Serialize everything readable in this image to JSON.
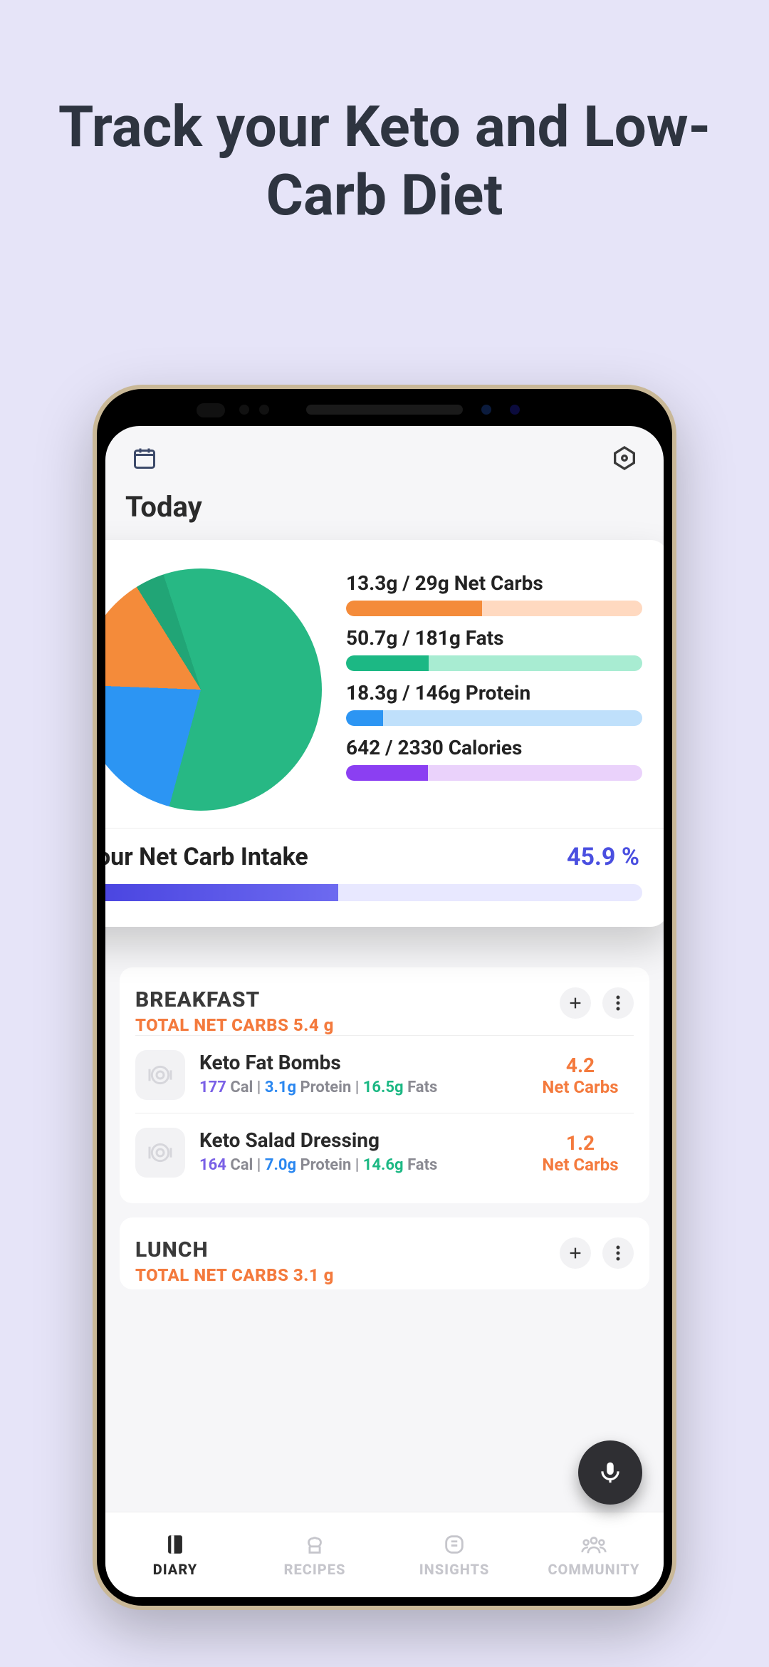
{
  "headline": "Track your Keto and Low-Carb Diet",
  "header": {
    "today_label": "Today"
  },
  "chart_data": {
    "type": "pie",
    "series": [
      {
        "name": "Fats",
        "value": 59.2,
        "color": "#27b884"
      },
      {
        "name": "Protein",
        "value": 21.4,
        "color": "#2c95f3"
      },
      {
        "name": "Net Carbs",
        "value": 15.5,
        "color": "#f48b3a"
      },
      {
        "name": "Other",
        "value": 3.9,
        "color": "#21a576"
      }
    ]
  },
  "macros": {
    "net_carbs": {
      "label": "13.3g / 29g Net Carbs",
      "consumed": 13.3,
      "goal": 29,
      "pct": 45.9,
      "fill": "#f48b3a",
      "track": "#ffd9c0"
    },
    "fats": {
      "label": "50.7g / 181g Fats",
      "consumed": 50.7,
      "goal": 181,
      "pct": 28.0,
      "fill": "#1cb884",
      "track": "#a8ecd2"
    },
    "protein": {
      "label": "18.3g / 146g Protein",
      "consumed": 18.3,
      "goal": 146,
      "pct": 12.5,
      "fill": "#2c95f3",
      "track": "#bfe0fb"
    },
    "calories": {
      "label": "642 / 2330 Calories",
      "consumed": 642,
      "goal": 2330,
      "pct": 27.6,
      "fill": "#8b3ff2",
      "track": "#ead2fb"
    }
  },
  "intake": {
    "title": "Your Net Carb Intake",
    "pct_text": "45.9 %",
    "pct": 45.9
  },
  "meals": {
    "breakfast": {
      "title": "BREAKFAST",
      "total_label": "TOTAL NET CARBS 5.4 g",
      "items": [
        {
          "name": "Keto Fat Bombs",
          "cal": "177",
          "protein": "3.1g",
          "fats": "16.5g",
          "net_carbs": "4.2"
        },
        {
          "name": "Keto Salad Dressing",
          "cal": "164",
          "protein": "7.0g",
          "fats": "14.6g",
          "net_carbs": "1.2"
        }
      ]
    },
    "lunch": {
      "title": "LUNCH",
      "total_label": "TOTAL NET CARBS 3.1 g"
    }
  },
  "labels": {
    "cal_suffix": " Cal",
    "protein_suffix": " Protein",
    "fats_suffix": " Fats",
    "net_carbs_label": "Net Carbs"
  },
  "nav": {
    "diary": "DIARY",
    "recipes": "RECIPES",
    "insights": "INSIGHTS",
    "community": "COMMUNITY"
  }
}
